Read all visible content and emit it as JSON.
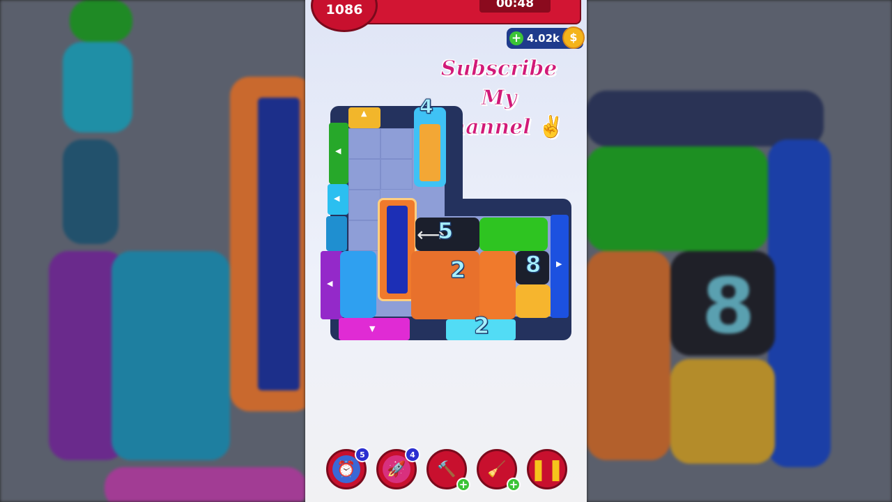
{
  "hud": {
    "level": "1086",
    "timer": "00:48",
    "coins": "4.02k",
    "coin_symbol": "$"
  },
  "overlay": {
    "line1": "Subscribe My",
    "line2": "Channel"
  },
  "board": {
    "blocks": [
      {
        "name": "cyan-block-4",
        "color": "#3fc2f5",
        "number": "4"
      },
      {
        "name": "orange-frame-blue-block",
        "color": "#f07a2c"
      },
      {
        "name": "black-mystery-block-5",
        "color": "#1b1f2c",
        "number": "5"
      },
      {
        "name": "green-block",
        "color": "#2ec421"
      },
      {
        "name": "blue-block",
        "color": "#2fa0f0"
      },
      {
        "name": "orange-mystery-block-2",
        "color": "#e8712c",
        "number": "2"
      },
      {
        "name": "orange-block",
        "color": "#f07a2c"
      },
      {
        "name": "black-mystery-block-8",
        "color": "#1b1f2c",
        "number": "8"
      },
      {
        "name": "yellow-block",
        "color": "#f6b52e"
      }
    ],
    "exit_gate_number": "2"
  },
  "tools": [
    {
      "name": "freeze-timer-tool",
      "icon": "clock-icon",
      "count": "5"
    },
    {
      "name": "rocket-tool",
      "icon": "rocket-icon",
      "count": "4"
    },
    {
      "name": "hammer-tool",
      "icon": "hammer-icon",
      "count": ""
    },
    {
      "name": "vacuum-tool",
      "icon": "vacuum-icon",
      "count": ""
    },
    {
      "name": "pause-button",
      "icon": "pause-icon",
      "count": ""
    }
  ]
}
